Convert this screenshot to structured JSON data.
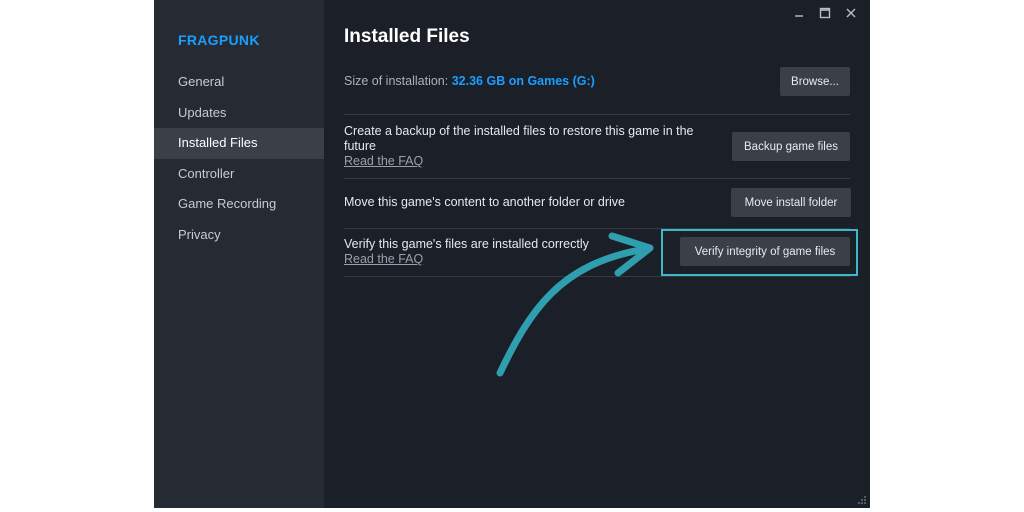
{
  "window": {
    "game_title": "FRAGPUNK",
    "controls": {
      "minimize_icon": "minimize-icon",
      "maximize_icon": "maximize-icon",
      "close_icon": "close-icon"
    }
  },
  "sidebar": {
    "items": [
      {
        "label": "General",
        "active": false
      },
      {
        "label": "Updates",
        "active": false
      },
      {
        "label": "Installed Files",
        "active": true
      },
      {
        "label": "Controller",
        "active": false
      },
      {
        "label": "Game Recording",
        "active": false
      },
      {
        "label": "Privacy",
        "active": false
      }
    ]
  },
  "main": {
    "title": "Installed Files",
    "size_label": "Size of installation:",
    "size_value": "32.36 GB on Games (G:)",
    "browse_label": "Browse...",
    "backup": {
      "line1": "Create a backup of the installed files to restore this game in the",
      "line2": "future",
      "faq": "Read the FAQ",
      "button": "Backup game files"
    },
    "move": {
      "text": "Move this game's content to another folder or drive",
      "button": "Move install folder"
    },
    "verify": {
      "text": "Verify this game's files are installed correctly",
      "faq": "Read the FAQ",
      "button": "Verify integrity of game files"
    }
  },
  "colors": {
    "accent": "#1a9fff",
    "highlight": "#3fb6c9",
    "background": "#1b1f27",
    "sidebar": "#262a32"
  },
  "annotation": {
    "arrow_icon": "curved-arrow-icon"
  }
}
